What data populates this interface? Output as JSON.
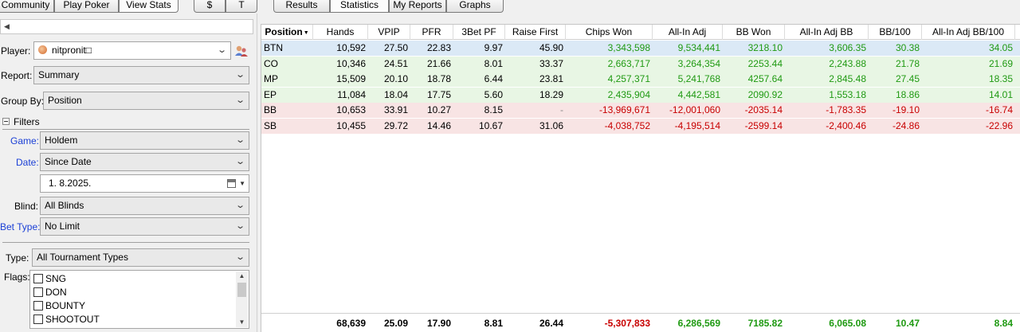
{
  "top_tabs": {
    "left": [
      "Community",
      "Play Poker",
      "View Stats"
    ],
    "currency": [
      "$",
      "T"
    ],
    "right": [
      "Results",
      "Statistics",
      "My Reports",
      "Graphs"
    ]
  },
  "left_panel": {
    "player_label": "Player:",
    "player_value": "nitpronit□",
    "report_label": "Report:",
    "report_value": "Summary",
    "group_by_label": "Group By:",
    "group_by_value": "Position",
    "filters_label": "Filters",
    "game_label": "Game:",
    "game_value": "Holdem",
    "date_label": "Date:",
    "date_value": "Since Date",
    "date_input": "1.  8.2025.",
    "blind_label": "Blind:",
    "blind_value": "All Blinds",
    "bet_type_label": "Bet Type:",
    "bet_type_value": "No Limit",
    "type_label": "Type:",
    "type_value": "All Tournament Types",
    "flags_label": "Flags:",
    "flags": [
      "SNG",
      "DON",
      "BOUNTY",
      "SHOOTOUT"
    ]
  },
  "colors": {
    "positive": "#1f9a12",
    "negative": "#c80000",
    "selected_row": "#dbe9f6",
    "positive_row": "#e8f6e4",
    "negative_row": "#f8e4e4",
    "label_blue": "#1a3fd6"
  },
  "table": {
    "columns": [
      "Position",
      "Hands",
      "VPIP",
      "PFR",
      "3Bet PF",
      "Raise First",
      "Chips Won",
      "All-In Adj",
      "BB Won",
      "All-In Adj BB",
      "BB/100",
      "All-In Adj BB/100"
    ],
    "sorted_column": "Position",
    "rows": [
      {
        "style": "sel",
        "cells": [
          "BTN",
          "10,592",
          "27.50",
          "22.83",
          "9.97",
          "45.90",
          "3,343,598",
          "9,534,441",
          "3218.10",
          "3,606.35",
          "30.38",
          "34.05"
        ],
        "tone": [
          "",
          "",
          "",
          "",
          "",
          "",
          "g",
          "g",
          "g",
          "g",
          "g",
          "g"
        ]
      },
      {
        "style": "pos",
        "cells": [
          "CO",
          "10,346",
          "24.51",
          "21.66",
          "8.01",
          "33.37",
          "2,663,717",
          "3,264,354",
          "2253.44",
          "2,243.88",
          "21.78",
          "21.69"
        ],
        "tone": [
          "",
          "",
          "",
          "",
          "",
          "",
          "g",
          "g",
          "g",
          "g",
          "g",
          "g"
        ]
      },
      {
        "style": "pos",
        "cells": [
          "MP",
          "15,509",
          "20.10",
          "18.78",
          "6.44",
          "23.81",
          "4,257,371",
          "5,241,768",
          "4257.64",
          "2,845.48",
          "27.45",
          "18.35"
        ],
        "tone": [
          "",
          "",
          "",
          "",
          "",
          "",
          "g",
          "g",
          "g",
          "g",
          "g",
          "g"
        ]
      },
      {
        "style": "pos",
        "cells": [
          "EP",
          "11,084",
          "18.04",
          "17.75",
          "5.60",
          "18.29",
          "2,435,904",
          "4,442,581",
          "2090.92",
          "1,553.18",
          "18.86",
          "14.01"
        ],
        "tone": [
          "",
          "",
          "",
          "",
          "",
          "",
          "g",
          "g",
          "g",
          "g",
          "g",
          "g"
        ]
      },
      {
        "style": "neg",
        "cells": [
          "BB",
          "10,653",
          "33.91",
          "10.27",
          "8.15",
          "-",
          "-13,969,671",
          "-12,001,060",
          "-2035.14",
          "-1,783.35",
          "-19.10",
          "-16.74"
        ],
        "tone": [
          "",
          "",
          "",
          "",
          "",
          "dash",
          "r",
          "r",
          "r",
          "r",
          "r",
          "r"
        ]
      },
      {
        "style": "neg",
        "cells": [
          "SB",
          "10,455",
          "29.72",
          "14.46",
          "10.67",
          "31.06",
          "-4,038,752",
          "-4,195,514",
          "-2599.14",
          "-2,400.46",
          "-24.86",
          "-22.96"
        ],
        "tone": [
          "",
          "",
          "",
          "",
          "",
          "",
          "r",
          "r",
          "r",
          "r",
          "r",
          "r"
        ]
      }
    ],
    "totals": {
      "cells": [
        "",
        "68,639",
        "25.09",
        "17.90",
        "8.81",
        "26.44",
        "-5,307,833",
        "6,286,569",
        "7185.82",
        "6,065.08",
        "10.47",
        "8.84"
      ],
      "tone": [
        "",
        "",
        "",
        "",
        "",
        "",
        "r",
        "g",
        "g",
        "g",
        "g",
        "g"
      ]
    }
  }
}
